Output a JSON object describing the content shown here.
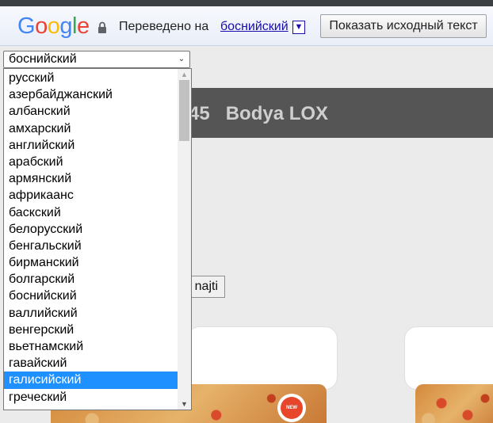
{
  "translate_bar": {
    "logo": "Google",
    "lock_icon": "lock-icon",
    "translated_label": "Переведено на",
    "language": "боснийский",
    "dropdown_arrow": "▼",
    "show_original": "Показать исходный текст"
  },
  "site": {
    "title": "45   Bodya LOX",
    "find_button": "najti",
    "badge": "NEW"
  },
  "language_select": {
    "value": "боснийский",
    "arrow": "⌄",
    "options": [
      "русский",
      "азербайджанский",
      "албанский",
      "амхарский",
      "английский",
      "арабский",
      "армянский",
      "африкаанс",
      "баскский",
      "белорусский",
      "бенгальский",
      "бирманский",
      "болгарский",
      "боснийский",
      "валлийский",
      "венгерский",
      "вьетнамский",
      "гавайский",
      "галисийский",
      "греческий"
    ],
    "highlighted": "галисийский",
    "scroll_up": "▲",
    "scroll_down": "▼"
  },
  "colors": {
    "highlight": "#1e90ff",
    "link": "#1a0dab",
    "header_bg": "#555555"
  }
}
